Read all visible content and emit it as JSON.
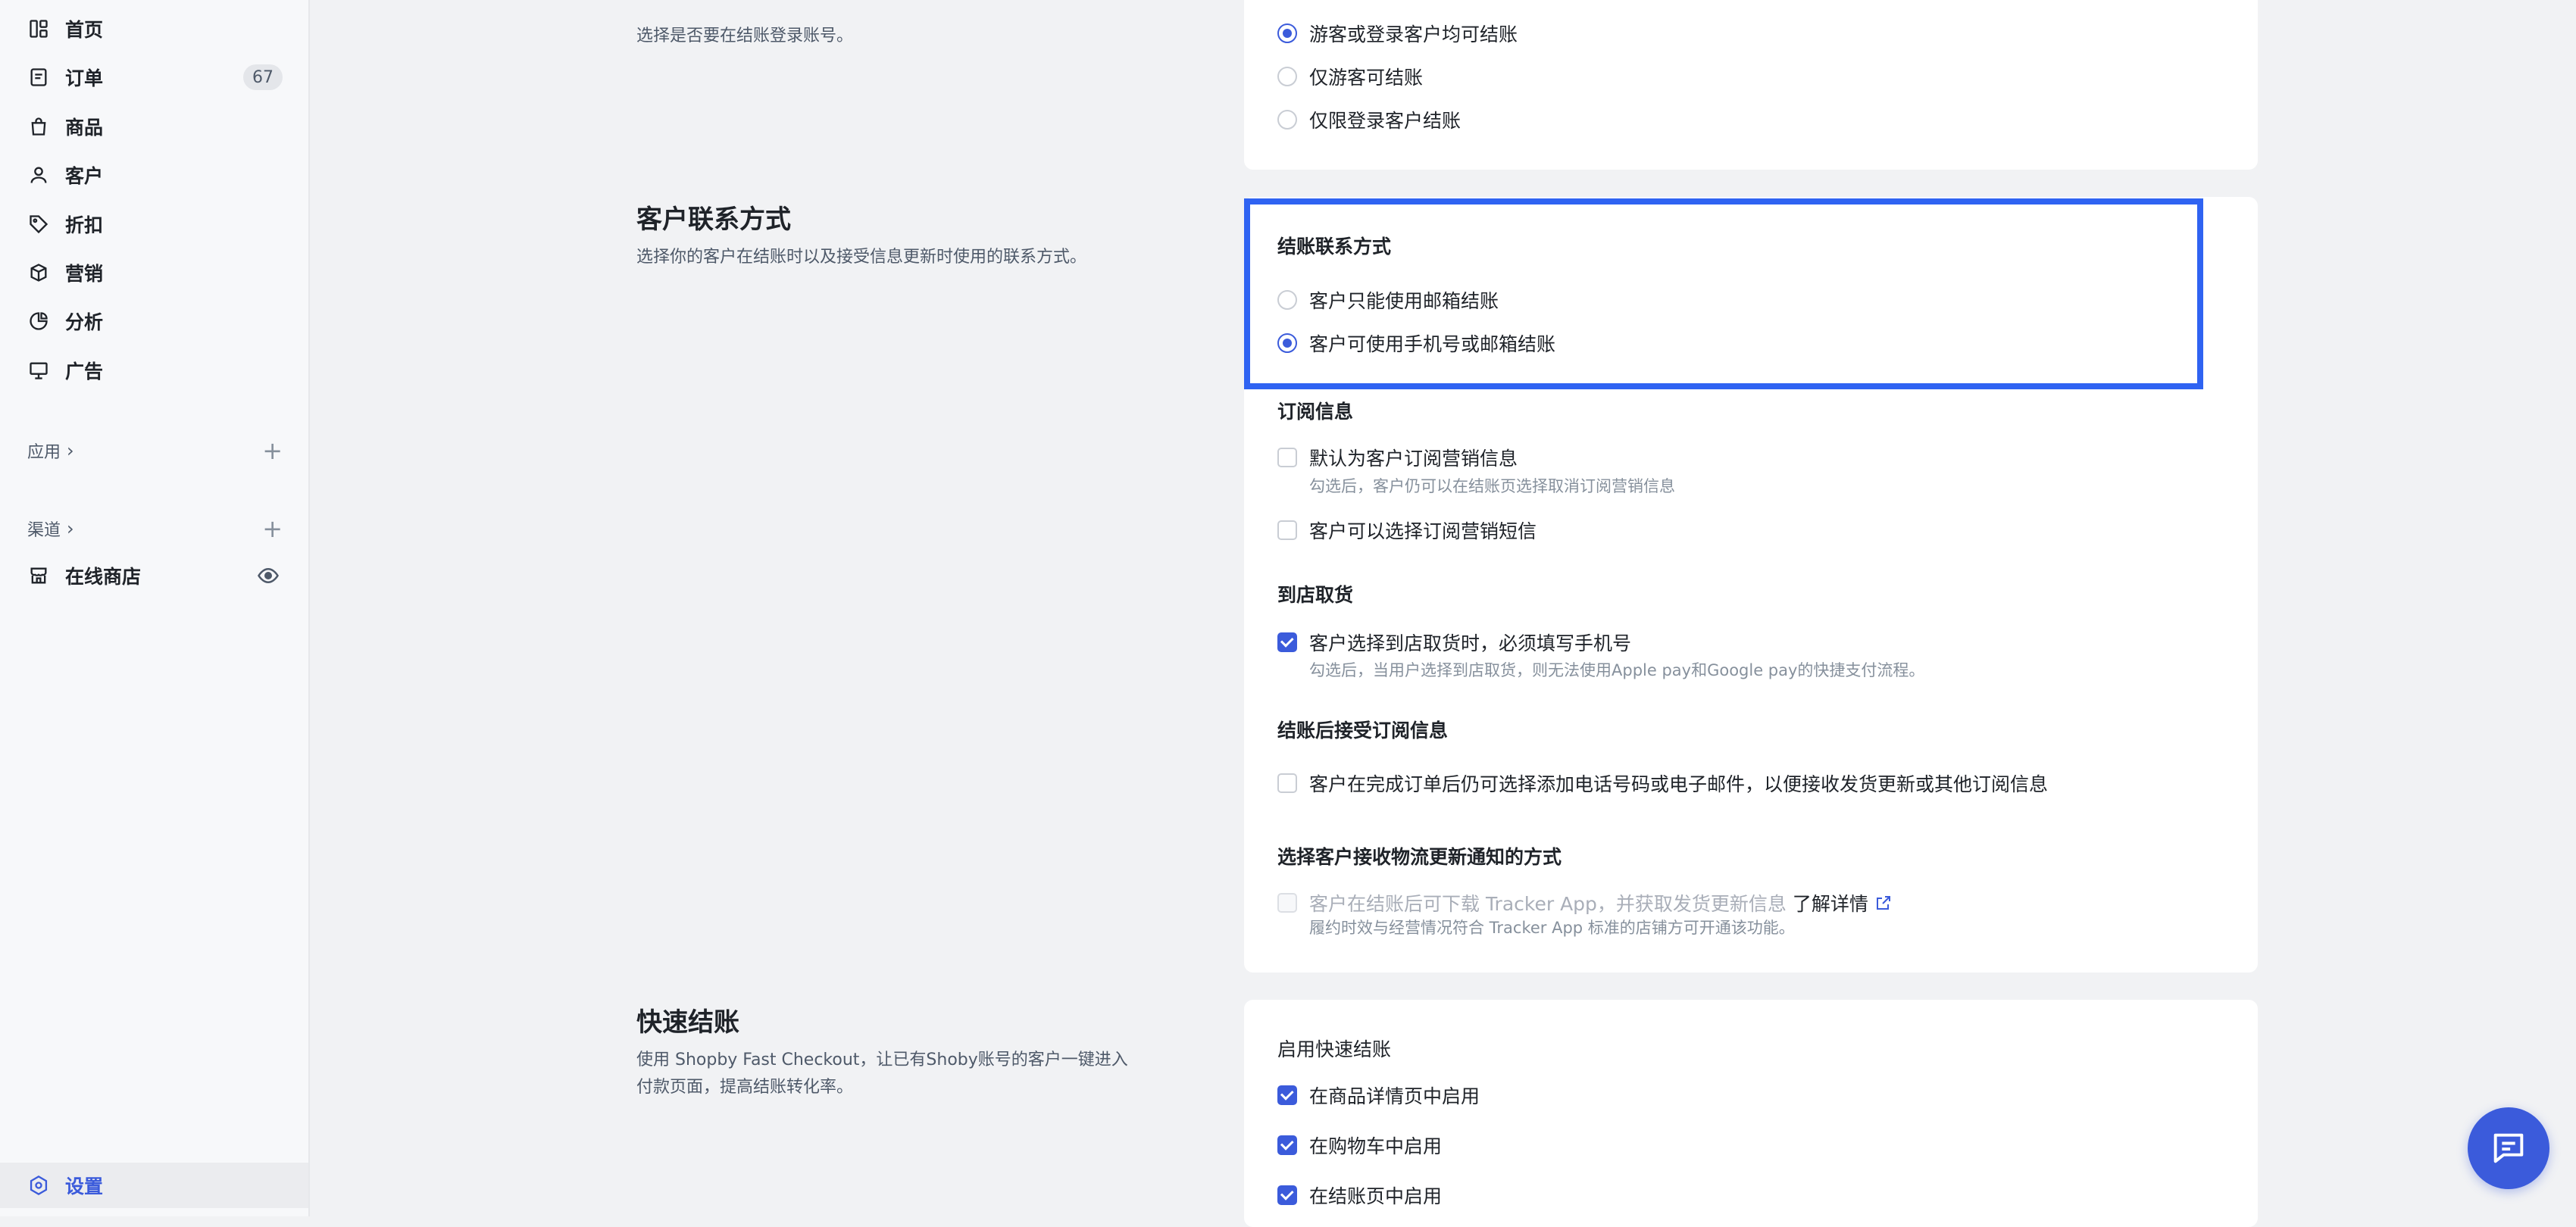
{
  "sidebar": {
    "nav": [
      {
        "label": "首页",
        "icon": "home-icon"
      },
      {
        "label": "订单",
        "icon": "order-icon",
        "badge": "67"
      },
      {
        "label": "商品",
        "icon": "bag-icon"
      },
      {
        "label": "客户",
        "icon": "user-icon"
      },
      {
        "label": "折扣",
        "icon": "tag-icon"
      },
      {
        "label": "营销",
        "icon": "box-icon"
      },
      {
        "label": "分析",
        "icon": "pie-chart-icon"
      },
      {
        "label": "广告",
        "icon": "ad-icon"
      }
    ],
    "apps_label": "应用",
    "channels_label": "渠道",
    "online_store": "在线商店",
    "settings": "设置"
  },
  "account": {
    "desc": "选择是否要在结账登录账号。",
    "options": [
      "游客或登录客户均可结账",
      "仅游客可结账",
      "仅限登录客户结账"
    ],
    "selected": 0
  },
  "contact": {
    "title": "客户联系方式",
    "desc": "选择你的客户在结账时以及接受信息更新时使用的联系方式。",
    "checkout_contact": {
      "label": "结账联系方式",
      "options": [
        "客户只能使用邮箱结账",
        "客户可使用手机号或邮箱结账"
      ],
      "selected": 1
    },
    "subscription": {
      "label": "订阅信息",
      "opt1": "默认为客户订阅营销信息",
      "opt1_hint": "勾选后，客户仍可以在结账页选择取消订阅营销信息",
      "opt2": "客户可以选择订阅营销短信"
    },
    "pickup": {
      "label": "到店取货",
      "opt": "客户选择到店取货时，必须填写手机号",
      "hint": "勾选后，当用户选择到店取货，则无法使用Apple pay和Google pay的快捷支付流程。"
    },
    "post_checkout": {
      "label": "结账后接受订阅信息",
      "opt": "客户在完成订单后仍可选择添加电话号码或电子邮件，以便接收发货更新或其他订阅信息"
    },
    "tracking": {
      "label": "选择客户接收物流更新通知的方式",
      "opt": "客户在结账后可下载 Tracker App，并获取发货更新信息",
      "link": "了解详情",
      "hint": "履约时效与经营情况符合 Tracker App 标准的店铺方可开通该功能。"
    }
  },
  "fast_checkout": {
    "title": "快速结账",
    "desc": "使用 Shopby Fast Checkout，让已有Shoby账号的客户一键进入付款页面，提高结账转化率。",
    "label": "启用快速结账",
    "options": [
      "在商品详情页中启用",
      "在购物车中启用",
      "在结账页中启用"
    ]
  },
  "colors": {
    "accent": "#3b5bdb",
    "highlight": "#2f63f2",
    "background": "#f1f2f4"
  }
}
